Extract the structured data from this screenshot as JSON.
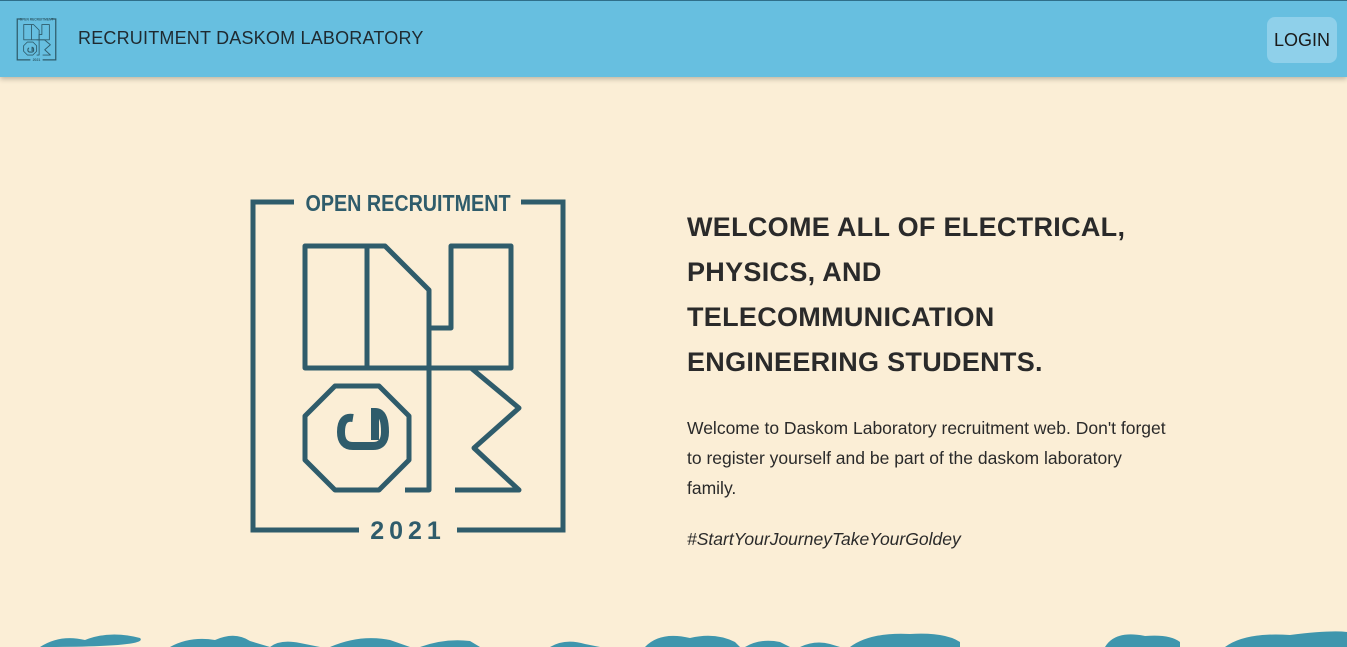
{
  "header": {
    "logo_text_top": "OPEN RECRUITMENT",
    "logo_year": "2021",
    "title": "RECRUITMENT DASKOM LABORATORY",
    "login_label": "LOGIN"
  },
  "hero": {
    "logo_text_top": "OPEN RECRUITMENT",
    "logo_year": "2021",
    "heading_lines": [
      "WELCOME ALL OF ELECTRICAL,",
      "PHYSICS, AND TELECOMMUNICATION",
      "ENGINEERING STUDENTS."
    ],
    "description": "Welcome to Daskom Laboratory recruitment web. Don't forget to register yourself and be part of the daskom laboratory family.",
    "hashtag": "#StartYourJourneyTakeYourGoldey"
  },
  "colors": {
    "background": "#fbeed6",
    "navbar": "#67bfe0",
    "logo": "#2f5c6b",
    "wave": "#3f96ad"
  }
}
